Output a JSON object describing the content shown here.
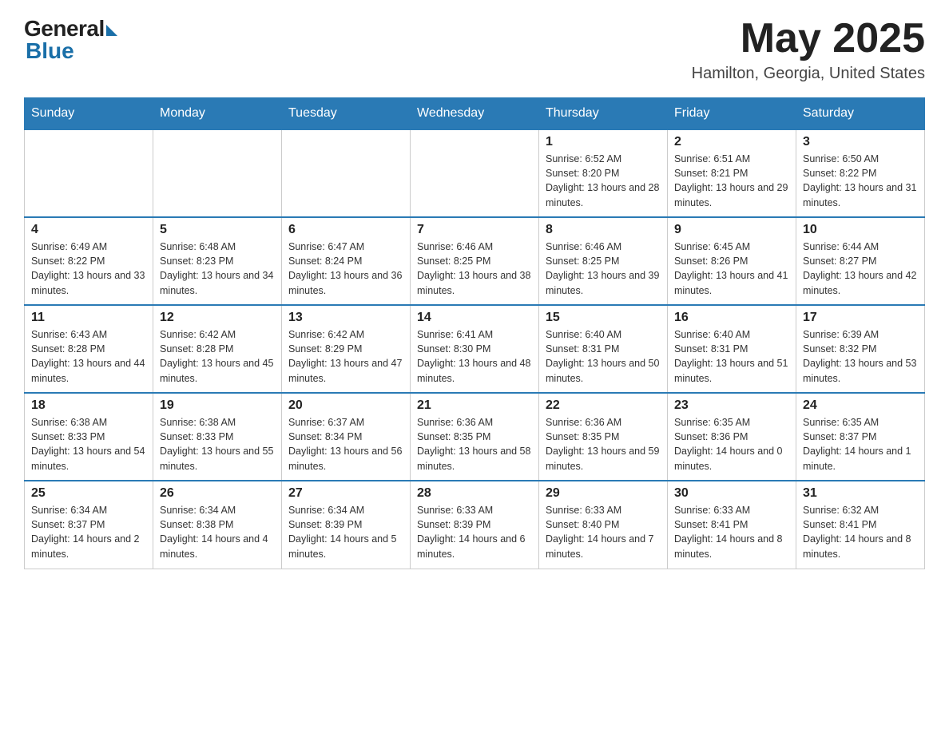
{
  "logo": {
    "general": "General",
    "blue": "Blue"
  },
  "header": {
    "month": "May 2025",
    "location": "Hamilton, Georgia, United States"
  },
  "weekdays": [
    "Sunday",
    "Monday",
    "Tuesday",
    "Wednesday",
    "Thursday",
    "Friday",
    "Saturday"
  ],
  "weeks": [
    [
      {
        "day": "",
        "info": ""
      },
      {
        "day": "",
        "info": ""
      },
      {
        "day": "",
        "info": ""
      },
      {
        "day": "",
        "info": ""
      },
      {
        "day": "1",
        "info": "Sunrise: 6:52 AM\nSunset: 8:20 PM\nDaylight: 13 hours and 28 minutes."
      },
      {
        "day": "2",
        "info": "Sunrise: 6:51 AM\nSunset: 8:21 PM\nDaylight: 13 hours and 29 minutes."
      },
      {
        "day": "3",
        "info": "Sunrise: 6:50 AM\nSunset: 8:22 PM\nDaylight: 13 hours and 31 minutes."
      }
    ],
    [
      {
        "day": "4",
        "info": "Sunrise: 6:49 AM\nSunset: 8:22 PM\nDaylight: 13 hours and 33 minutes."
      },
      {
        "day": "5",
        "info": "Sunrise: 6:48 AM\nSunset: 8:23 PM\nDaylight: 13 hours and 34 minutes."
      },
      {
        "day": "6",
        "info": "Sunrise: 6:47 AM\nSunset: 8:24 PM\nDaylight: 13 hours and 36 minutes."
      },
      {
        "day": "7",
        "info": "Sunrise: 6:46 AM\nSunset: 8:25 PM\nDaylight: 13 hours and 38 minutes."
      },
      {
        "day": "8",
        "info": "Sunrise: 6:46 AM\nSunset: 8:25 PM\nDaylight: 13 hours and 39 minutes."
      },
      {
        "day": "9",
        "info": "Sunrise: 6:45 AM\nSunset: 8:26 PM\nDaylight: 13 hours and 41 minutes."
      },
      {
        "day": "10",
        "info": "Sunrise: 6:44 AM\nSunset: 8:27 PM\nDaylight: 13 hours and 42 minutes."
      }
    ],
    [
      {
        "day": "11",
        "info": "Sunrise: 6:43 AM\nSunset: 8:28 PM\nDaylight: 13 hours and 44 minutes."
      },
      {
        "day": "12",
        "info": "Sunrise: 6:42 AM\nSunset: 8:28 PM\nDaylight: 13 hours and 45 minutes."
      },
      {
        "day": "13",
        "info": "Sunrise: 6:42 AM\nSunset: 8:29 PM\nDaylight: 13 hours and 47 minutes."
      },
      {
        "day": "14",
        "info": "Sunrise: 6:41 AM\nSunset: 8:30 PM\nDaylight: 13 hours and 48 minutes."
      },
      {
        "day": "15",
        "info": "Sunrise: 6:40 AM\nSunset: 8:31 PM\nDaylight: 13 hours and 50 minutes."
      },
      {
        "day": "16",
        "info": "Sunrise: 6:40 AM\nSunset: 8:31 PM\nDaylight: 13 hours and 51 minutes."
      },
      {
        "day": "17",
        "info": "Sunrise: 6:39 AM\nSunset: 8:32 PM\nDaylight: 13 hours and 53 minutes."
      }
    ],
    [
      {
        "day": "18",
        "info": "Sunrise: 6:38 AM\nSunset: 8:33 PM\nDaylight: 13 hours and 54 minutes."
      },
      {
        "day": "19",
        "info": "Sunrise: 6:38 AM\nSunset: 8:33 PM\nDaylight: 13 hours and 55 minutes."
      },
      {
        "day": "20",
        "info": "Sunrise: 6:37 AM\nSunset: 8:34 PM\nDaylight: 13 hours and 56 minutes."
      },
      {
        "day": "21",
        "info": "Sunrise: 6:36 AM\nSunset: 8:35 PM\nDaylight: 13 hours and 58 minutes."
      },
      {
        "day": "22",
        "info": "Sunrise: 6:36 AM\nSunset: 8:35 PM\nDaylight: 13 hours and 59 minutes."
      },
      {
        "day": "23",
        "info": "Sunrise: 6:35 AM\nSunset: 8:36 PM\nDaylight: 14 hours and 0 minutes."
      },
      {
        "day": "24",
        "info": "Sunrise: 6:35 AM\nSunset: 8:37 PM\nDaylight: 14 hours and 1 minute."
      }
    ],
    [
      {
        "day": "25",
        "info": "Sunrise: 6:34 AM\nSunset: 8:37 PM\nDaylight: 14 hours and 2 minutes."
      },
      {
        "day": "26",
        "info": "Sunrise: 6:34 AM\nSunset: 8:38 PM\nDaylight: 14 hours and 4 minutes."
      },
      {
        "day": "27",
        "info": "Sunrise: 6:34 AM\nSunset: 8:39 PM\nDaylight: 14 hours and 5 minutes."
      },
      {
        "day": "28",
        "info": "Sunrise: 6:33 AM\nSunset: 8:39 PM\nDaylight: 14 hours and 6 minutes."
      },
      {
        "day": "29",
        "info": "Sunrise: 6:33 AM\nSunset: 8:40 PM\nDaylight: 14 hours and 7 minutes."
      },
      {
        "day": "30",
        "info": "Sunrise: 6:33 AM\nSunset: 8:41 PM\nDaylight: 14 hours and 8 minutes."
      },
      {
        "day": "31",
        "info": "Sunrise: 6:32 AM\nSunset: 8:41 PM\nDaylight: 14 hours and 8 minutes."
      }
    ]
  ]
}
